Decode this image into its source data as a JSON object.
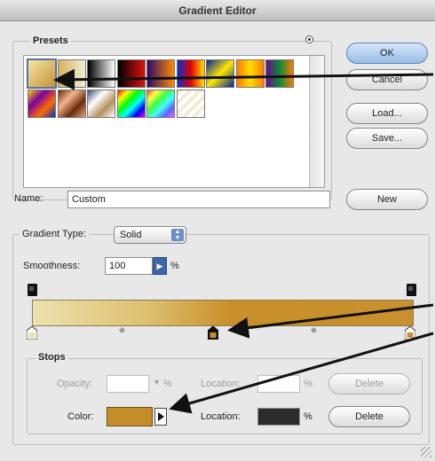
{
  "window": {
    "title": "Gradient Editor"
  },
  "presets": {
    "label": "Presets",
    "menu_icon": "circle-arrow-icon",
    "swatches": [
      {
        "name": "preset-gold",
        "css": "linear-gradient(135deg,#f3e6a8,#c59236)"
      },
      {
        "name": "preset-gold-transparent",
        "css": "linear-gradient(90deg,#d6b35a,#f1ecd8)"
      },
      {
        "name": "preset-black-white",
        "css": "linear-gradient(90deg,#000,#fff)"
      },
      {
        "name": "preset-red-black",
        "css": "linear-gradient(90deg,#000,#e01010)"
      },
      {
        "name": "preset-violet-orange",
        "css": "linear-gradient(90deg,#2a0a6a,#ff8a00)"
      },
      {
        "name": "preset-blue-red-yellow",
        "css": "linear-gradient(90deg,#0030d0,#e00000,#ffe000)"
      },
      {
        "name": "preset-blue-yellow-blue",
        "css": "linear-gradient(135deg,#0020a0,#ffe800,#0020a0)"
      },
      {
        "name": "preset-orange-yellow-orange",
        "css": "linear-gradient(90deg,#ff7a00,#ffe000,#ff7a00)"
      },
      {
        "name": "preset-violet-green-orange",
        "css": "linear-gradient(90deg,#6a0a8a,#0a8a3a,#ff7a00)"
      },
      {
        "name": "preset-yellow-violet-orange-blue",
        "css": "linear-gradient(135deg,#ffd000,#7a00a0,#ff6a00,#0030c0)"
      },
      {
        "name": "preset-copper",
        "css": "linear-gradient(135deg,#6a2a10,#f3b58a,#6a2a10,#e8a57a)"
      },
      {
        "name": "preset-chrome",
        "css": "linear-gradient(135deg,#3a4a7a,#ffffff,#b09060,#ffffff)"
      },
      {
        "name": "preset-spectrum",
        "css": "linear-gradient(135deg,#ff0000,#ffff00,#00ff00,#00ffff,#0000ff,#ff00ff)"
      },
      {
        "name": "preset-transparent-rainbow",
        "css": "linear-gradient(135deg,#ff4040,#ffff40,#40ff40,#40ffff,#6060ff,#ff60ff)"
      },
      {
        "name": "preset-transparent-stripes",
        "css": "repeating-linear-gradient(135deg,#f2ecd6 0 4px,#ffffff 4px 8px)"
      }
    ]
  },
  "buttons": {
    "ok": "OK",
    "cancel": "Cancel",
    "load": "Load...",
    "save": "Save...",
    "new": "New"
  },
  "name_field": {
    "label": "Name:",
    "value": "Custom"
  },
  "gradient_type": {
    "label": "Gradient Type:",
    "selected": "Solid",
    "smoothness_label": "Smoothness:",
    "smoothness_value": "100",
    "smoothness_unit": "%"
  },
  "gradient_bar": {
    "colors": [
      "#ece2ae",
      "#ddc070",
      "#c98f2a",
      "#c8902f"
    ]
  },
  "stops": {
    "label": "Stops",
    "opacity_label": "Opacity:",
    "opacity_value": "",
    "opacity_unit": "%",
    "opacity_location_label": "Location:",
    "opacity_location_value": "",
    "opacity_location_unit": "%",
    "opacity_delete": "Delete",
    "color_label": "Color:",
    "color_value": "#c58c2a",
    "color_location_label": "Location:",
    "color_location_value": "",
    "color_location_unit": "%",
    "color_delete": "Delete"
  }
}
